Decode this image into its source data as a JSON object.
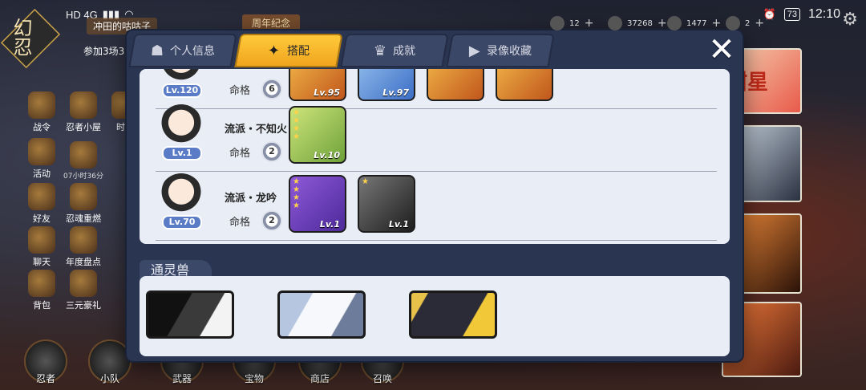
{
  "status_bar": {
    "network": "HD 4G",
    "battery": "73",
    "clock": "12:10"
  },
  "player": {
    "name": "冲田的咕咕子",
    "sub": "参加3场3"
  },
  "event_banner": "周年纪念",
  "resources": [
    {
      "icon": "house-icon",
      "value": "12"
    },
    {
      "icon": "coin-icon",
      "value": "37268"
    },
    {
      "icon": "gem-icon",
      "value": "1477"
    },
    {
      "icon": "token-icon",
      "value": "2"
    }
  ],
  "logo_text": "幻忍",
  "side_menu": [
    {
      "name": "battle-pass",
      "label": "战令"
    },
    {
      "name": "ninja-house",
      "label": "忍者小屋"
    },
    {
      "name": "time-event",
      "label": "时光"
    },
    {
      "name": "activity",
      "label": "活动"
    },
    {
      "name": "timer-event",
      "label": "",
      "timer": "07小时36分"
    },
    {
      "name": "friends",
      "label": "好友"
    },
    {
      "name": "soul-reforge",
      "label": "忍魂重燃"
    },
    {
      "name": "chat",
      "label": "聊天"
    },
    {
      "name": "annual-review",
      "label": "年度盘点"
    },
    {
      "name": "backpack",
      "label": "背包"
    },
    {
      "name": "sanyuan-gift",
      "label": "三元豪礼"
    }
  ],
  "bottom_nav": [
    {
      "name": "ninja",
      "label": "忍者"
    },
    {
      "name": "squad",
      "label": "小队"
    },
    {
      "name": "weapon",
      "label": "武器"
    },
    {
      "name": "treasure",
      "label": "宝物"
    },
    {
      "name": "shop",
      "label": "商店"
    },
    {
      "name": "summon",
      "label": "召唤"
    }
  ],
  "right_art": {
    "card_text": "甜星"
  },
  "dialog": {
    "tabs": [
      {
        "label": "个人信息",
        "icon": "profile-icon",
        "active": false
      },
      {
        "label": "搭配",
        "icon": "shuriken-icon",
        "active": true
      },
      {
        "label": "成就",
        "icon": "trophy-icon",
        "active": false
      },
      {
        "label": "录像收藏",
        "icon": "play-icon",
        "active": false
      }
    ],
    "close_label": "✕",
    "ninjas": [
      {
        "level": "Lv.120",
        "style": "",
        "fate_label": "命格",
        "fate_value": "6",
        "equips": [
          {
            "color": "orange",
            "stars": "",
            "level": "Lv.95"
          },
          {
            "color": "blue",
            "stars": "",
            "level": "Lv.97"
          },
          {
            "color": "orange",
            "stars": "",
            "level": ""
          },
          {
            "color": "orange",
            "stars": "",
            "level": ""
          }
        ]
      },
      {
        "level": "Lv.1",
        "style": "流派・不知火",
        "fate_label": "命格",
        "fate_value": "2",
        "equips": [
          {
            "color": "green",
            "stars": "★★★★",
            "level": "Lv.10"
          }
        ]
      },
      {
        "level": "Lv.70",
        "style": "流派・龙吟",
        "fate_label": "命格",
        "fate_value": "2",
        "equips": [
          {
            "color": "purple",
            "stars": "★★★★",
            "level": "Lv.1"
          },
          {
            "color": "gray",
            "stars": "★",
            "level": "Lv.1"
          }
        ]
      }
    ],
    "summon_section_title": "通灵兽",
    "summon_beasts": [
      {
        "name": "black-wolf-beast"
      },
      {
        "name": "white-eagle-beast"
      },
      {
        "name": "dark-raven-beast"
      }
    ]
  }
}
